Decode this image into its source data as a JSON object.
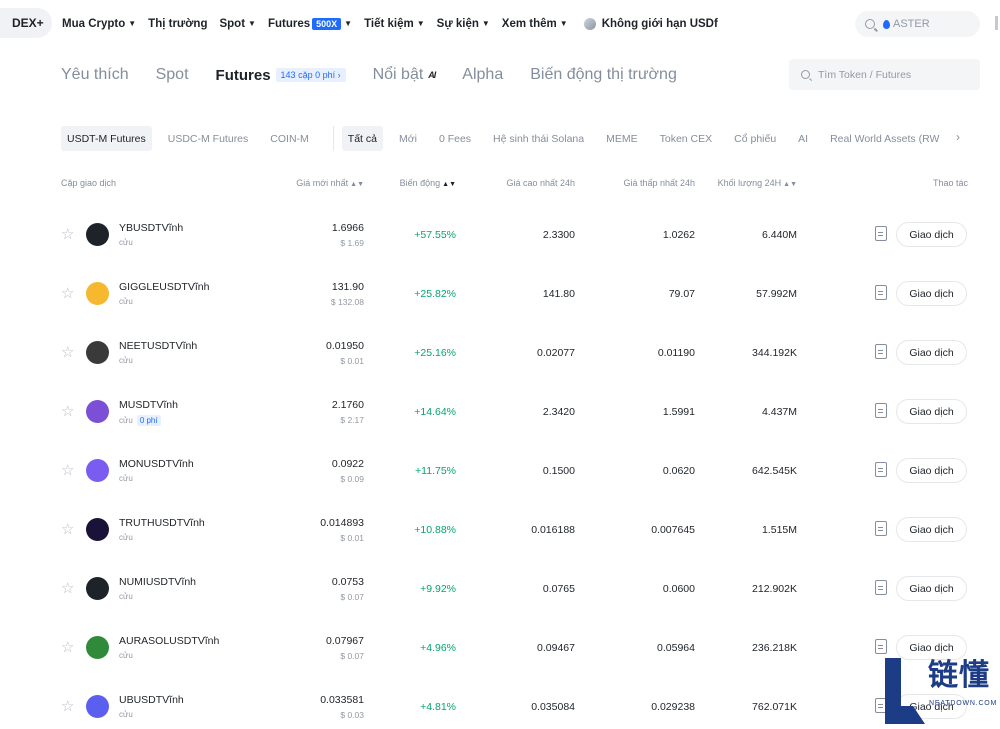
{
  "topnav": {
    "dex": "DEX+",
    "links": [
      {
        "label": "Mua Crypto",
        "caret": true
      },
      {
        "label": "Thị trường",
        "caret": false
      },
      {
        "label": "Spot",
        "caret": true
      },
      {
        "label": "Futures",
        "caret": true,
        "badge": "500X"
      },
      {
        "label": "Tiết kiệm",
        "caret": true
      },
      {
        "label": "Sự kiện",
        "caret": true
      },
      {
        "label": "Xem thêm",
        "caret": true
      }
    ],
    "usdf_label": "Không giới hạn USDf",
    "search_placeholder": "ASTER"
  },
  "maintabs": {
    "favorites": "Yêu thích",
    "spot": "Spot",
    "futures": "Futures",
    "futures_badge": "143 cặp 0 phí ›",
    "featured": "Nổi bật",
    "featured_mark": "AI",
    "alpha": "Alpha",
    "movers": "Biến động thị trường"
  },
  "main_search_placeholder": "Tìm Token / Futures",
  "filters": {
    "contract_types": [
      "USDT-M Futures",
      "USDC-M Futures",
      "COIN-M"
    ],
    "categories": [
      "Tất cả",
      "Mới",
      "0 Fees",
      "Hệ sinh thái Solana",
      "MEME",
      "Token CEX",
      "Cổ phiếu",
      "AI",
      "Real World Assets (RW"
    ]
  },
  "table": {
    "headers": {
      "pair": "Cặp giao dịch",
      "last_price": "Giá mới nhất",
      "change": "Biến động",
      "high": "Giá cao nhất 24h",
      "low": "Giá thấp nhất 24h",
      "volume": "Khối lượng 24H",
      "action": "Thao tác"
    },
    "trade_label": "Giao dịch",
    "rows": [
      {
        "symbol": "YBUSDTVĩnh",
        "sub": "cửu",
        "price": "1.6966",
        "price_usd": "$ 1.69",
        "change": "+57.55%",
        "high": "2.3300",
        "low": "1.0262",
        "volume": "6.440M",
        "icon": "yb-logo-icon",
        "color": "#1e2329"
      },
      {
        "symbol": "GIGGLEUSDTVĩnh",
        "sub": "cửu",
        "price": "131.90",
        "price_usd": "$ 132.08",
        "change": "+25.82%",
        "high": "141.80",
        "low": "79.07",
        "volume": "57.992M",
        "icon": "giggle-logo-icon",
        "color": "#f5b82e"
      },
      {
        "symbol": "NEETUSDTVĩnh",
        "sub": "cửu",
        "price": "0.01950",
        "price_usd": "$ 0.01",
        "change": "+25.16%",
        "high": "0.02077",
        "low": "0.01190",
        "volume": "344.192K",
        "icon": "neet-logo-icon",
        "color": "#3a3a3a"
      },
      {
        "symbol": "MUSDTVĩnh",
        "sub": "cửu",
        "fee_tag": "0 phí",
        "price": "2.1760",
        "price_usd": "$ 2.17",
        "change": "+14.64%",
        "high": "2.3420",
        "low": "1.5991",
        "volume": "4.437M",
        "icon": "m-logo-icon",
        "color": "#7b4fd6"
      },
      {
        "symbol": "MONUSDTVĩnh",
        "sub": "cửu",
        "price": "0.0922",
        "price_usd": "$ 0.09",
        "change": "+11.75%",
        "high": "0.1500",
        "low": "0.0620",
        "volume": "642.545K",
        "icon": "mon-logo-icon",
        "color": "#7b5cf0"
      },
      {
        "symbol": "TRUTHUSDTVĩnh",
        "sub": "cửu",
        "price": "0.014893",
        "price_usd": "$ 0.01",
        "change": "+10.88%",
        "high": "0.016188",
        "low": "0.007645",
        "volume": "1.515M",
        "icon": "truth-logo-icon",
        "color": "#1a1238"
      },
      {
        "symbol": "NUMIUSDTVĩnh",
        "sub": "cửu",
        "price": "0.0753",
        "price_usd": "$ 0.07",
        "change": "+9.92%",
        "high": "0.0765",
        "low": "0.0600",
        "volume": "212.902K",
        "icon": "numi-logo-icon",
        "color": "#1e2329"
      },
      {
        "symbol": "AURASOLUSDTVĩnh",
        "sub": "cửu",
        "price": "0.07967",
        "price_usd": "$ 0.07",
        "change": "+4.96%",
        "high": "0.09467",
        "low": "0.05964",
        "volume": "236.218K",
        "icon": "aurasol-logo-icon",
        "color": "#2f8a3a"
      },
      {
        "symbol": "UBUSDTVĩnh",
        "sub": "cửu",
        "price": "0.033581",
        "price_usd": "$ 0.03",
        "change": "+4.81%",
        "high": "0.035084",
        "low": "0.029238",
        "volume": "762.071K",
        "icon": "ub-logo-icon",
        "color": "#5a5ff0"
      }
    ]
  },
  "watermark": {
    "main": "链懂",
    "sub": "NEATDOWN.COM"
  }
}
